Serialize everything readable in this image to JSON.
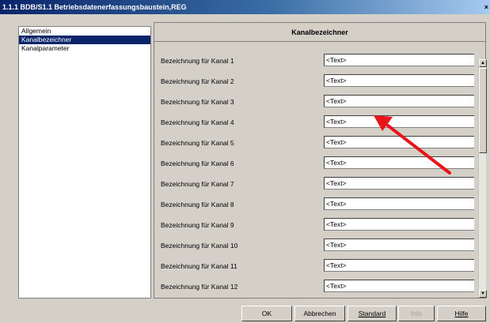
{
  "window": {
    "title": "1.1.1 BDB/S1.1 Betriebsdatenerfassungsbaustein,REG",
    "close_glyph": "×"
  },
  "tree": {
    "items": [
      {
        "label": "Allgemein",
        "selected": false
      },
      {
        "label": "Kanalbezeichner",
        "selected": true
      },
      {
        "label": "Kanalparameter",
        "selected": false
      }
    ]
  },
  "panel": {
    "header": "Kanalbezeichner",
    "rows": [
      {
        "label": "Bezeichnung für Kanal 1",
        "value": "<Text>"
      },
      {
        "label": "Bezeichnung für Kanal 2",
        "value": "<Text>"
      },
      {
        "label": "Bezeichnung für Kanal 3",
        "value": "<Text>"
      },
      {
        "label": "Bezeichnung für Kanal 4",
        "value": "<Text>"
      },
      {
        "label": "Bezeichnung für Kanal 5",
        "value": "<Text>"
      },
      {
        "label": "Bezeichnung für Kanal 6",
        "value": "<Text>"
      },
      {
        "label": "Bezeichnung für Kanal 7",
        "value": "<Text>"
      },
      {
        "label": "Bezeichnung für Kanal 8",
        "value": "<Text>"
      },
      {
        "label": "Bezeichnung für Kanal 9",
        "value": "<Text>"
      },
      {
        "label": "Bezeichnung für Kanal 10",
        "value": "<Text>"
      },
      {
        "label": "Bezeichnung für Kanal 11",
        "value": "<Text>"
      },
      {
        "label": "Bezeichnung für Kanal 12",
        "value": "<Text>"
      }
    ]
  },
  "buttons": {
    "ok": "OK",
    "cancel": "Abbrechen",
    "standard": "Standard",
    "info": "Info",
    "help": "Hilfe"
  },
  "colors": {
    "annotation_arrow": "#e8141a",
    "selection": "#0a246a"
  }
}
